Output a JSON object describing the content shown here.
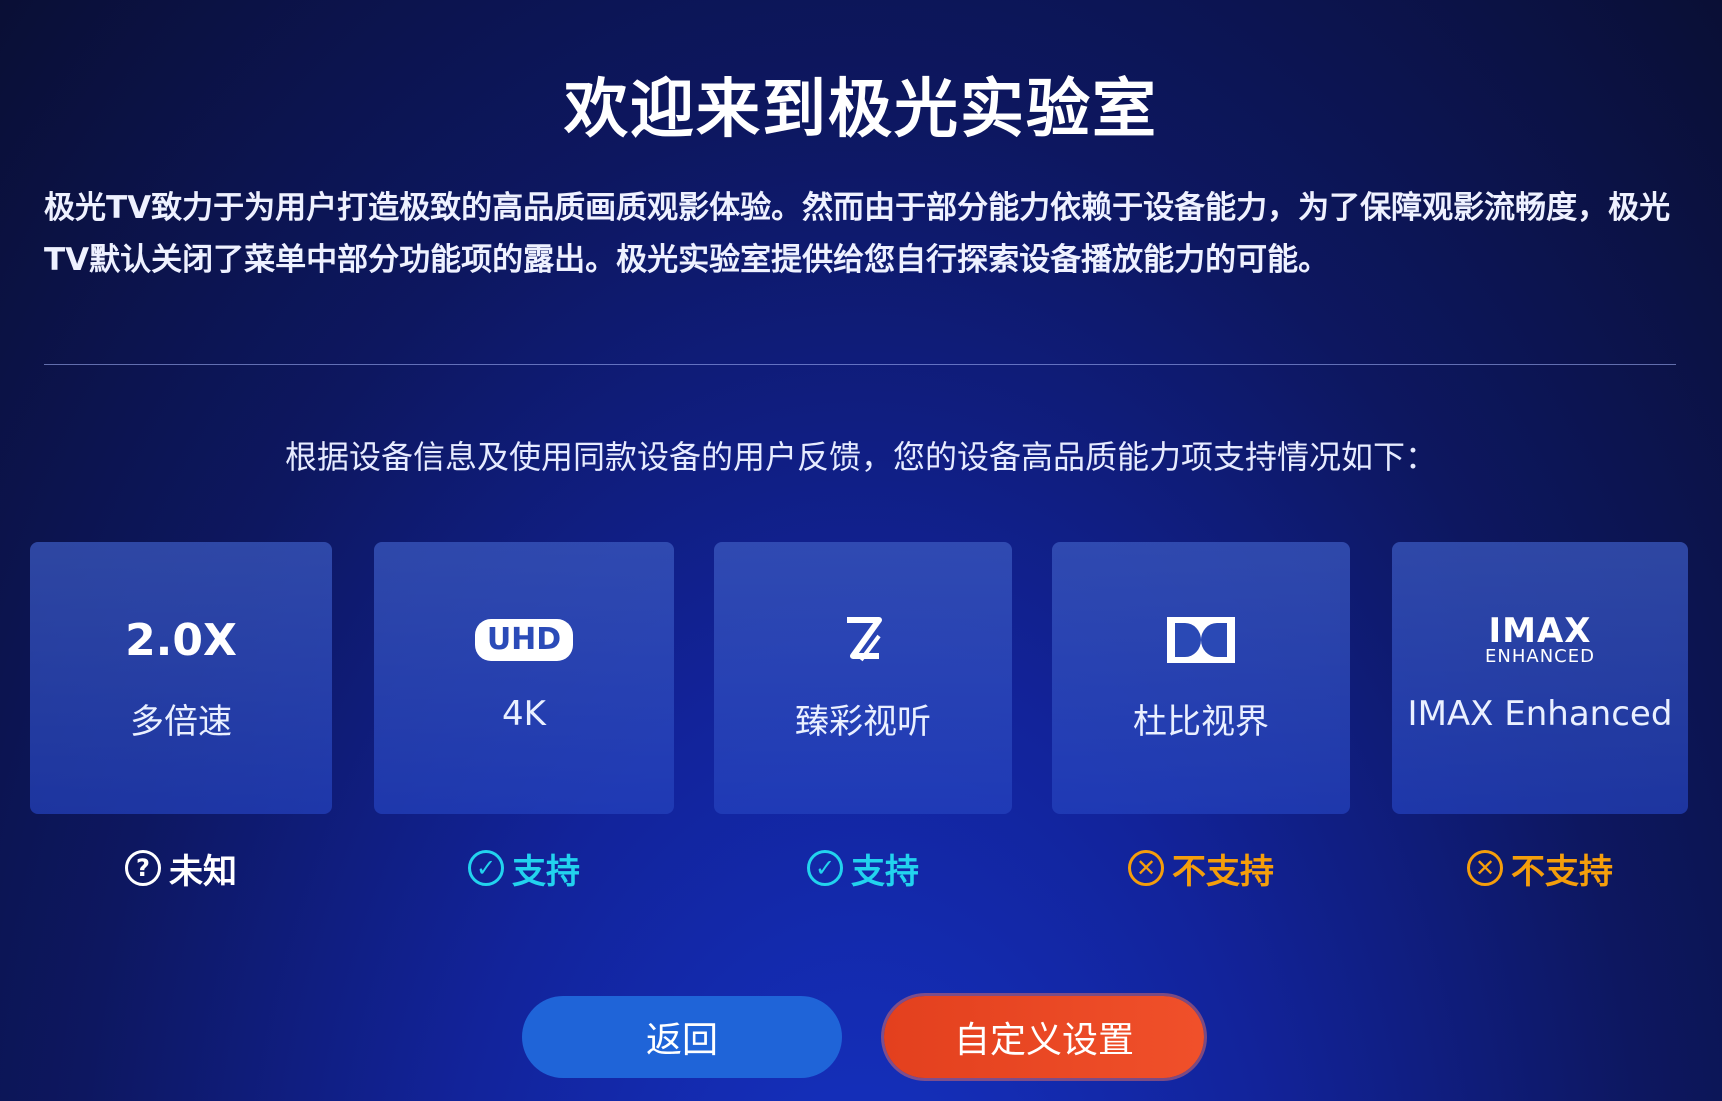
{
  "title": "欢迎来到极光实验室",
  "intro": "极光TV致力于为用户打造极致的高品质画质观影体验。然而由于部分能力依赖于设备能力，为了保障观影流畅度，极光TV默认关闭了菜单中部分功能项的露出。极光实验室提供给您自行探索设备播放能力的可能。",
  "subtitle": "根据设备信息及使用同款设备的用户反馈，您的设备高品质能力项支持情况如下：",
  "cards": [
    {
      "icon_text": "2.0X",
      "icon_name": "speed-icon",
      "label": "多倍速",
      "status": "未知",
      "status_icon": "question-icon",
      "status_color": "#ffffff"
    },
    {
      "icon_text": "UHD",
      "icon_name": "uhd-icon",
      "label": "4K",
      "status": "支持",
      "status_icon": "check-icon",
      "status_color": "#22d3ee"
    },
    {
      "icon_text": "",
      "icon_name": "vivid-color-icon",
      "label": "臻彩视听",
      "status": "支持",
      "status_icon": "check-icon",
      "status_color": "#22d3ee"
    },
    {
      "icon_text": "",
      "icon_name": "dolby-vision-icon",
      "label": "杜比视界",
      "status": "不支持",
      "status_icon": "x-circle-icon",
      "status_color": "#f59e0b"
    },
    {
      "icon_text": "IMAX",
      "icon_subtext": "ENHANCED",
      "icon_name": "imax-enhanced-icon",
      "label": "IMAX Enhanced",
      "status": "不支持",
      "status_icon": "x-circle-icon",
      "status_color": "#f59e0b"
    }
  ],
  "buttons": {
    "back": "返回",
    "custom": "自定义设置"
  },
  "colors": {
    "supported": "#22d3ee",
    "unsupported": "#f59e0b",
    "primary_button": "#1f64d8",
    "accent_button": "#e8451f"
  }
}
